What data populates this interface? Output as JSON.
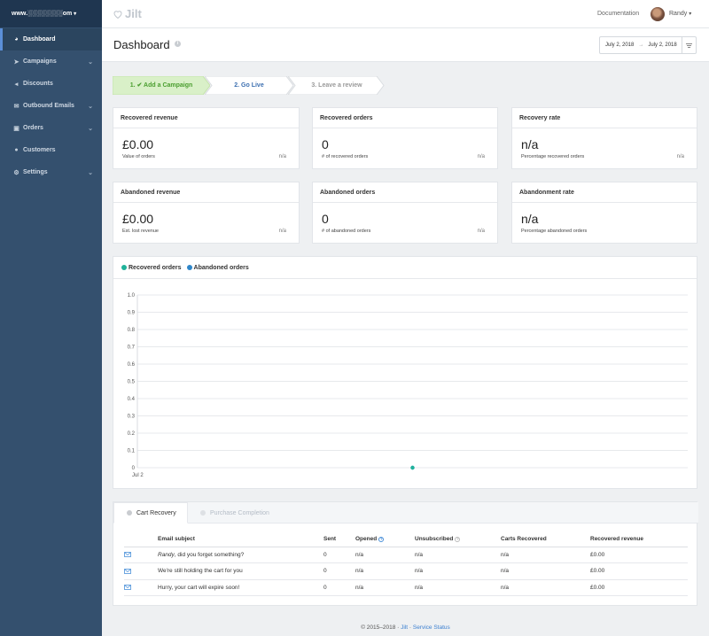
{
  "sidebar": {
    "site": "www.░░░░░░░░om",
    "items": [
      {
        "label": "Dashboard",
        "icon": "dashboard-icon",
        "active": true
      },
      {
        "label": "Campaigns",
        "icon": "paper-plane-icon",
        "has_children": true
      },
      {
        "label": "Discounts",
        "icon": "tag-icon"
      },
      {
        "label": "Outbound Emails",
        "icon": "envelope-icon",
        "has_children": true
      },
      {
        "label": "Orders",
        "icon": "money-icon",
        "has_children": true
      },
      {
        "label": "Customers",
        "icon": "users-icon"
      },
      {
        "label": "Settings",
        "icon": "gear-icon",
        "has_children": true
      }
    ]
  },
  "topbar": {
    "logo": "Jilt",
    "documentation": "Documentation",
    "user": "Randy"
  },
  "header": {
    "title": "Dashboard",
    "date_from": "July 2, 2018",
    "date_arrow": "→",
    "date_to": "July 2, 2018"
  },
  "steps": [
    {
      "label": "1. ✔ Add a Campaign",
      "state": "done"
    },
    {
      "label": "2. Go Live",
      "state": "current"
    },
    {
      "label": "3. Leave a review",
      "state": "todo"
    }
  ],
  "stats": [
    {
      "title": "Recovered revenue",
      "value": "£0.00",
      "sub": "Value of orders",
      "na": "n/a"
    },
    {
      "title": "Recovered orders",
      "value": "0",
      "sub": "# of recovered orders",
      "na": "n/a"
    },
    {
      "title": "Recovery rate",
      "value": "n/a",
      "sub": "Percentage recovered orders",
      "na": "n/a"
    },
    {
      "title": "Abandoned revenue",
      "value": "£0.00",
      "sub": "Est. lost revenue",
      "na": "n/a"
    },
    {
      "title": "Abandoned orders",
      "value": "0",
      "sub": "# of abandoned orders",
      "na": "n/a"
    },
    {
      "title": "Abandonment rate",
      "value": "n/a",
      "sub": "Percentage abandoned orders",
      "na": ""
    }
  ],
  "chart_data": {
    "type": "line",
    "x": [
      "Jul 2"
    ],
    "series": [
      {
        "name": "Recovered orders",
        "color": "#1fb29a",
        "values": [
          0
        ]
      },
      {
        "name": "Abandoned orders",
        "color": "#2f86c9",
        "values": [
          0
        ]
      }
    ],
    "yticks": [
      "0",
      "0.1",
      "0.2",
      "0.3",
      "0.4",
      "0.5",
      "0.6",
      "0.7",
      "0.8",
      "0.9",
      "1.0"
    ],
    "ylim": [
      0,
      1
    ],
    "grid": true,
    "legend": "top-left"
  },
  "emails": {
    "tabs": [
      "Cart Recovery",
      "Purchase Completion"
    ],
    "columns": [
      "Email subject",
      "Sent",
      "Opened",
      "Unsubscribed",
      "Carts Recovered",
      "Recovered revenue"
    ],
    "rows": [
      {
        "subject_name": "Randy",
        "subject_rest": ", did you forget something?",
        "sent": "0",
        "opened": "n/a",
        "unsub": "n/a",
        "carts": "n/a",
        "revenue": "£0.00"
      },
      {
        "subject_name": "",
        "subject_rest": "We're still holding the cart for you",
        "sent": "0",
        "opened": "n/a",
        "unsub": "n/a",
        "carts": "n/a",
        "revenue": "£0.00"
      },
      {
        "subject_name": "",
        "subject_rest": "Hurry, your cart will expire soon!",
        "sent": "0",
        "opened": "n/a",
        "unsub": "n/a",
        "carts": "n/a",
        "revenue": "£0.00"
      }
    ]
  },
  "footer": {
    "copyright": "© 2015–2018 · ",
    "jilt": "Jilt",
    "sep": " · ",
    "status": "Service Status"
  }
}
